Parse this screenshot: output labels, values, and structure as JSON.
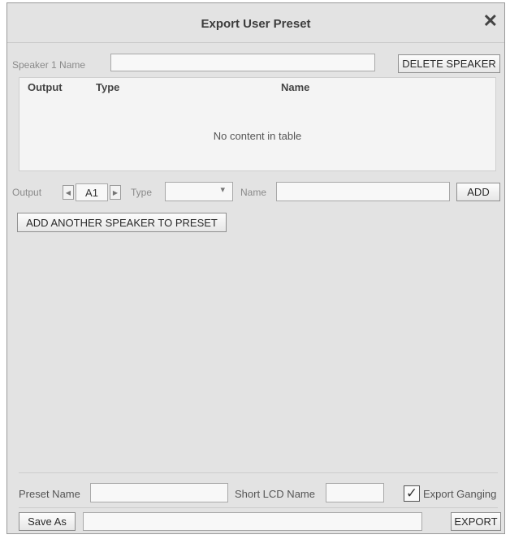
{
  "dialog": {
    "title": "Export User Preset",
    "close_glyph": "✕"
  },
  "speaker": {
    "name_label": "Speaker 1 Name",
    "name_value": "",
    "delete_label": "DELETE SPEAKER"
  },
  "table": {
    "columns": [
      "Output",
      "Type",
      "Name"
    ],
    "empty_text": "No content in table"
  },
  "entry": {
    "output_label": "Output",
    "output_value": "A1",
    "prev_glyph": "◀",
    "next_glyph": "▶",
    "type_label": "Type",
    "type_value": "",
    "type_arrow": "▾",
    "name_label": "Name",
    "name_value": "",
    "add_label": "ADD"
  },
  "add_speaker_label": "ADD ANOTHER SPEAKER TO PRESET",
  "footer": {
    "preset_name_label": "Preset Name",
    "preset_name_value": "",
    "short_lcd_label": "Short LCD Name",
    "short_lcd_value": "",
    "export_ganging_label": "Export Ganging",
    "export_ganging_checked": true,
    "check_glyph": "✓",
    "save_as_label": "Save As",
    "save_path_value": "",
    "export_label": "EXPORT"
  },
  "icons": [
    "close-icon",
    "chevron-left-icon",
    "chevron-right-icon",
    "dropdown-arrow-icon",
    "checkmark-icon"
  ]
}
